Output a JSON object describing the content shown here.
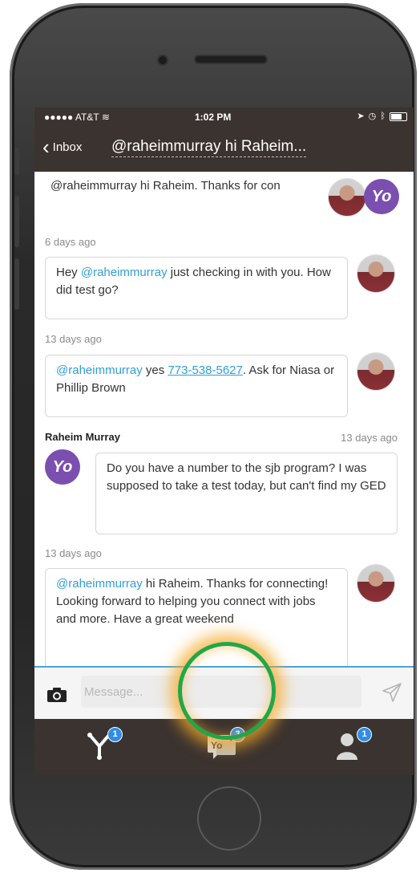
{
  "statusbar": {
    "carrier": "●●●●● AT&T",
    "time": "1:02 PM"
  },
  "nav": {
    "back_label": "Inbox",
    "title": "@raheimmurray hi Raheim..."
  },
  "thread": {
    "preview": "@raheimmurray hi Raheim. Thanks for con",
    "yo_logo": "Yo",
    "messages": [
      {
        "time": "6 days ago",
        "mention": "@raheimmurray",
        "text": " just checking in with you. How did test go?",
        "prefix": "Hey "
      },
      {
        "time": "13 days ago",
        "mention": "@raheimmurray",
        "text_before": " yes ",
        "phone": "773-538-5627",
        "text_after": ". Ask for Niasa or Phillip Brown"
      },
      {
        "sender": "Raheim Murray",
        "time": "13 days ago",
        "text": "Do you have a number to the sjb program? I was supposed to take a test today, but can't find my GED"
      },
      {
        "time": "13 days ago",
        "mention": "@raheimmurray",
        "text": " hi Raheim. Thanks for connecting! Looking forward to helping you connect with jobs and more. Have a great weekend"
      }
    ]
  },
  "compose": {
    "placeholder": "Message..."
  },
  "tabs": [
    {
      "name": "home",
      "badge": "1"
    },
    {
      "name": "messages",
      "badge": "3",
      "label": "Yo"
    },
    {
      "name": "profile",
      "badge": "1"
    }
  ],
  "colors": {
    "bar": "#3b332f",
    "accent": "#2f9fd8",
    "brand": "#7b4fb0",
    "highlight_ring": "#22a64a",
    "glow": "#f5aa28"
  },
  "icons": [
    "back-chevron-icon",
    "wifi-icon",
    "battery-icon",
    "camera-icon",
    "send-icon",
    "yo-network-icon",
    "yo-chat-icon",
    "person-icon"
  ]
}
